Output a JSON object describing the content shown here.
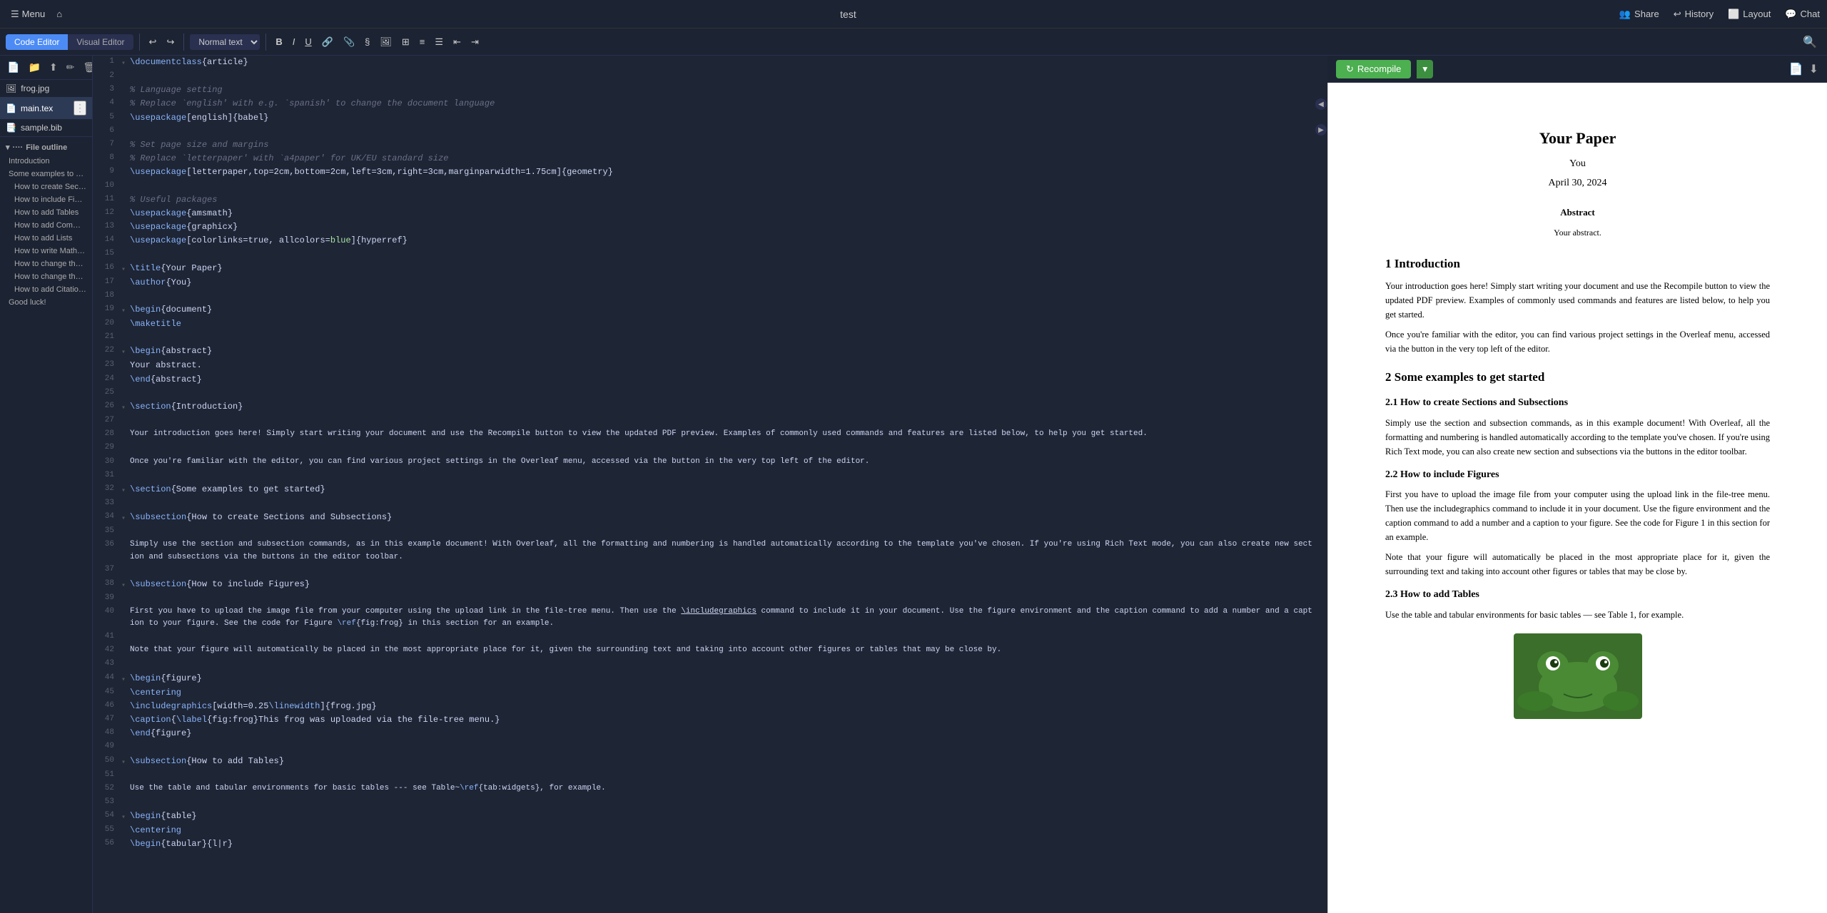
{
  "topbar": {
    "menu_label": "Menu",
    "home_icon": "⌂",
    "title": "test",
    "share_label": "Share",
    "history_label": "History",
    "layout_label": "Layout",
    "chat_label": "Chat"
  },
  "toolbar": {
    "code_editor_label": "Code Editor",
    "visual_editor_label": "Visual Editor",
    "undo_title": "Undo",
    "redo_title": "Redo",
    "style_options": [
      "Normal text"
    ],
    "bold_label": "B",
    "italic_label": "I",
    "search_icon": "🔍"
  },
  "sidebar": {
    "files": [
      {
        "name": "frog.jpg",
        "icon": "🖼",
        "active": false
      },
      {
        "name": "main.tex",
        "icon": "📄",
        "active": true
      },
      {
        "name": "sample.bib",
        "icon": "📑",
        "active": false
      }
    ]
  },
  "outline": {
    "header": "File outline",
    "items": [
      {
        "label": "Introduction",
        "level": 1
      },
      {
        "label": "Some examples to get st...",
        "level": 1
      },
      {
        "label": "How to create Sectio...",
        "level": 2
      },
      {
        "label": "How to include Figur...",
        "level": 2
      },
      {
        "label": "How to add Tables",
        "level": 2
      },
      {
        "label": "How to add Comme...",
        "level": 2
      },
      {
        "label": "How to add Lists",
        "level": 2
      },
      {
        "label": "How to write Mathe...",
        "level": 2
      },
      {
        "label": "How to change the ...",
        "level": 2
      },
      {
        "label": "How to change the d...",
        "level": 2
      },
      {
        "label": "How to add Citation...",
        "level": 2
      },
      {
        "label": "Good luck!",
        "level": 1
      }
    ]
  },
  "editor": {
    "lines": [
      {
        "num": 1,
        "content": "\\documentclass{article}"
      },
      {
        "num": 2,
        "content": ""
      },
      {
        "num": 3,
        "content": "% Language setting"
      },
      {
        "num": 4,
        "content": "% Replace `english' with e.g. `spanish' to change the document language"
      },
      {
        "num": 5,
        "content": "\\usepackage[english]{babel}"
      },
      {
        "num": 6,
        "content": ""
      },
      {
        "num": 7,
        "content": "% Set page size and margins"
      },
      {
        "num": 8,
        "content": "% Replace `letterpaper' with `a4paper' for UK/EU standard size"
      },
      {
        "num": 9,
        "content": "\\usepackage[letterpaper,top=2cm,bottom=2cm,left=3cm,right=3cm,marginparwidth=1.75cm]{geometry}"
      },
      {
        "num": 10,
        "content": ""
      },
      {
        "num": 11,
        "content": "% Useful packages"
      },
      {
        "num": 12,
        "content": "\\usepackage{amsmath}"
      },
      {
        "num": 13,
        "content": "\\usepackage{graphicx}"
      },
      {
        "num": 14,
        "content": "\\usepackage[colorlinks=true, allcolors=blue]{hyperref}"
      },
      {
        "num": 15,
        "content": ""
      },
      {
        "num": 16,
        "content": "\\title{Your Paper}"
      },
      {
        "num": 17,
        "content": "\\author{You}"
      },
      {
        "num": 18,
        "content": ""
      },
      {
        "num": 19,
        "content": "\\begin{document}"
      },
      {
        "num": 20,
        "content": "\\maketitle"
      },
      {
        "num": 21,
        "content": ""
      },
      {
        "num": 22,
        "content": "\\begin{abstract}"
      },
      {
        "num": 23,
        "content": "Your abstract."
      },
      {
        "num": 24,
        "content": "\\end{abstract}"
      },
      {
        "num": 25,
        "content": ""
      },
      {
        "num": 26,
        "content": "\\section{Introduction}"
      },
      {
        "num": 27,
        "content": ""
      },
      {
        "num": 28,
        "content": "Your introduction goes here! Simply start writing your document and use the Recompile button to view the updated PDF preview. Examples of commonly used commands and features are listed below, to help you get started."
      },
      {
        "num": 29,
        "content": ""
      },
      {
        "num": 30,
        "content": "Once you're familiar with the editor, you can find various project settings in the Overleaf menu, accessed via the button in the very top left of the editor."
      },
      {
        "num": 31,
        "content": ""
      },
      {
        "num": 32,
        "content": "\\section{Some examples to get started}"
      },
      {
        "num": 33,
        "content": ""
      },
      {
        "num": 34,
        "content": "\\subsection{How to create Sections and Subsections}"
      },
      {
        "num": 35,
        "content": ""
      },
      {
        "num": 36,
        "content": "Simply use the section and subsection commands, as in this example document! With Overleaf, all the formatting and numbering is handled automatically according to the template you've chosen. If you're using Rich Text mode, you can also create new section and subsections via the buttons in the editor toolbar."
      },
      {
        "num": 37,
        "content": ""
      },
      {
        "num": 38,
        "content": "\\subsection{How to include Figures}"
      },
      {
        "num": 39,
        "content": ""
      },
      {
        "num": 40,
        "content": "First you have to upload the image file from your computer using the upload link in the file-tree menu. Then use the \\includegraphics command to include it in your document. Use the figure environment and the caption command to add a number and a caption to your figure. See the code for Figure \\ref{fig:frog} in this section for an example."
      },
      {
        "num": 41,
        "content": ""
      },
      {
        "num": 42,
        "content": "Note that your figure will automatically be placed in the most appropriate place for it, given the surrounding text and taking into account other figures or tables that may be close by."
      },
      {
        "num": 43,
        "content": ""
      },
      {
        "num": 44,
        "content": "\\begin{figure}"
      },
      {
        "num": 45,
        "content": "\\centering"
      },
      {
        "num": 46,
        "content": "\\includegraphics[width=0.25\\linewidth]{frog.jpg}"
      },
      {
        "num": 47,
        "content": "\\caption{\\label{fig:frog}This frog was uploaded via the file-tree menu.}"
      },
      {
        "num": 48,
        "content": "\\end{figure}"
      },
      {
        "num": 49,
        "content": ""
      },
      {
        "num": 50,
        "content": "\\subsection{How to add Tables}"
      },
      {
        "num": 51,
        "content": ""
      },
      {
        "num": 52,
        "content": "Use the table and tabular environments for basic tables --- see Table~\\ref{tab:widgets}, for example."
      },
      {
        "num": 53,
        "content": ""
      },
      {
        "num": 54,
        "content": "\\begin{table}"
      },
      {
        "num": 55,
        "content": "\\centering"
      },
      {
        "num": 56,
        "content": "\\begin{tabular}{l|r}"
      }
    ]
  },
  "preview": {
    "recompile_label": "Recompile",
    "paper_title": "Your Paper",
    "paper_author": "You",
    "paper_date": "April 30, 2024",
    "abstract_title": "Abstract",
    "abstract_text": "Your abstract.",
    "section1": "1   Introduction",
    "section1_p1": "Your introduction goes here! Simply start writing your document and use the Recompile button to view the updated PDF preview. Examples of commonly used commands and features are listed below, to help you get started.",
    "section1_p2": "Once you're familiar with the editor, you can find various project settings in the Overleaf menu, accessed via the button in the very top left of the editor.",
    "section2": "2   Some examples to get started",
    "subsec21": "2.1   How to create Sections and Subsections",
    "subsec21_p": "Simply use the section and subsection commands, as in this example document! With Overleaf, all the formatting and numbering is handled automatically according to the template you've chosen. If you're using Rich Text mode, you can also create new section and subsections via the buttons in the editor toolbar.",
    "subsec22": "2.2   How to include Figures",
    "subsec22_p1": "First you have to upload the image file from your computer using the upload link in the file-tree menu. Then use the includegraphics command to include it in your document. Use the figure environment and the caption command to add a number and a caption to your figure. See the code for Figure 1 in this section for an example.",
    "subsec22_p2": "Note that your figure will automatically be placed in the most appropriate place for it, given the surrounding text and taking into account other figures or tables that may be close by.",
    "subsec23": "2.3   How to add Tables",
    "subsec23_p": "Use the table and tabular environments for basic tables — see Table 1, for example."
  },
  "colors": {
    "recompile_bg": "#4caf50",
    "active_file_bg": "#2d3a55",
    "code_editor_active": "#4c8bf5",
    "keyword_color": "#89b4fa",
    "comment_color": "#6c7086",
    "link_color": "#4c8bf5"
  }
}
